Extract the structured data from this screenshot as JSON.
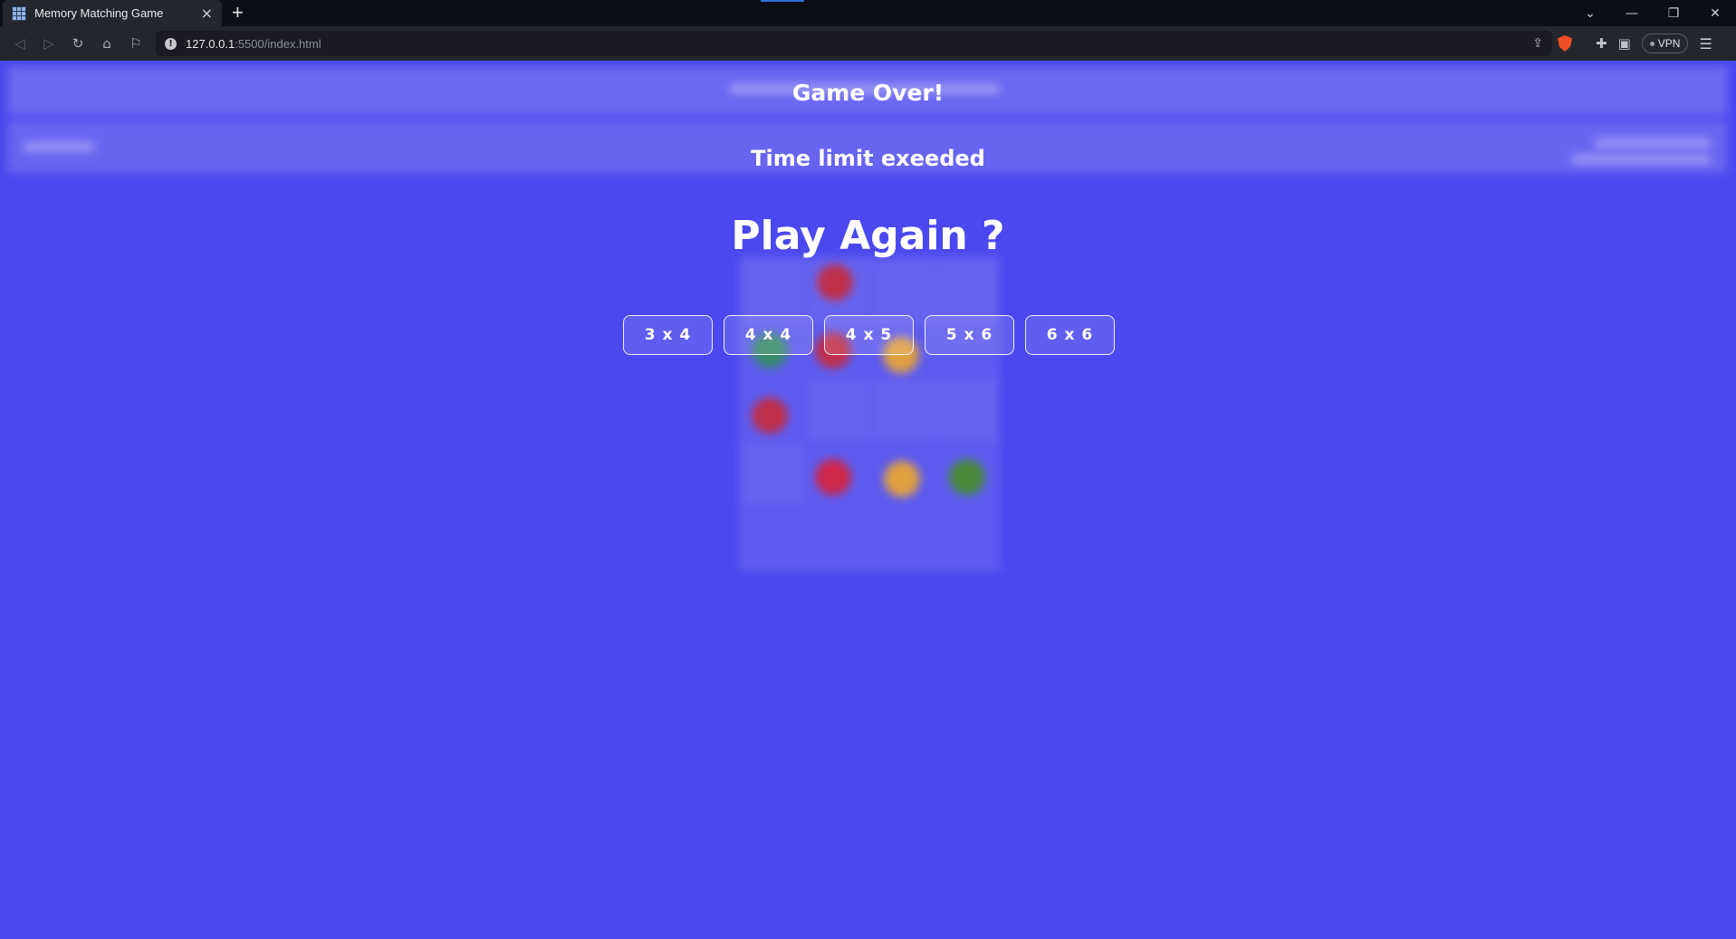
{
  "browser": {
    "tab_title": "Memory Matching Game",
    "new_tab_symbol": "+",
    "close_symbol": "×",
    "url_host": "127.0.0.1",
    "url_path": ":5500/index.html",
    "vpn_label": "VPN"
  },
  "game_over": {
    "title": "Game Over!",
    "reason": "Time limit exeeded",
    "prompt": "Play Again ?",
    "sizes": [
      {
        "label": "3 x 4"
      },
      {
        "label": "4 x 4"
      },
      {
        "label": "4 x 5"
      },
      {
        "label": "5 x 6"
      },
      {
        "label": "6 x 6"
      }
    ]
  },
  "colors": {
    "page_background": "#4a48ee",
    "chrome_dark": "#0c0e16",
    "toolbar": "#24262e"
  }
}
